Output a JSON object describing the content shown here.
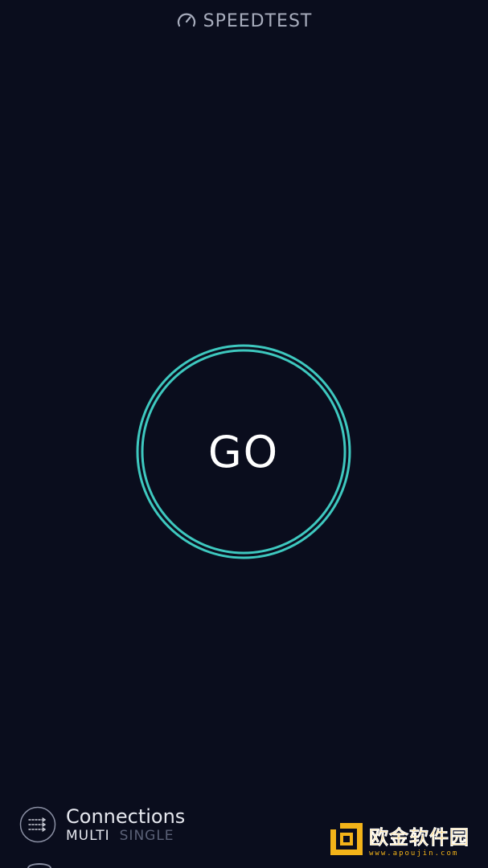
{
  "header": {
    "brand": "SPEEDTEST",
    "icon": "speedometer-icon"
  },
  "go_button": {
    "label": "GO",
    "ring_color": "#3ec8bf"
  },
  "connections": {
    "icon": "connections-arrows-icon",
    "title": "Connections",
    "options": [
      "MULTI",
      "SINGLE"
    ],
    "selected": "MULTI"
  },
  "watermark": {
    "name": "欧金软件园",
    "url": "www.apoujin.com",
    "color": "#f3b319"
  },
  "colors": {
    "background": "#0a0d1d",
    "accent": "#3ec8bf",
    "muted": "#5b6177"
  }
}
